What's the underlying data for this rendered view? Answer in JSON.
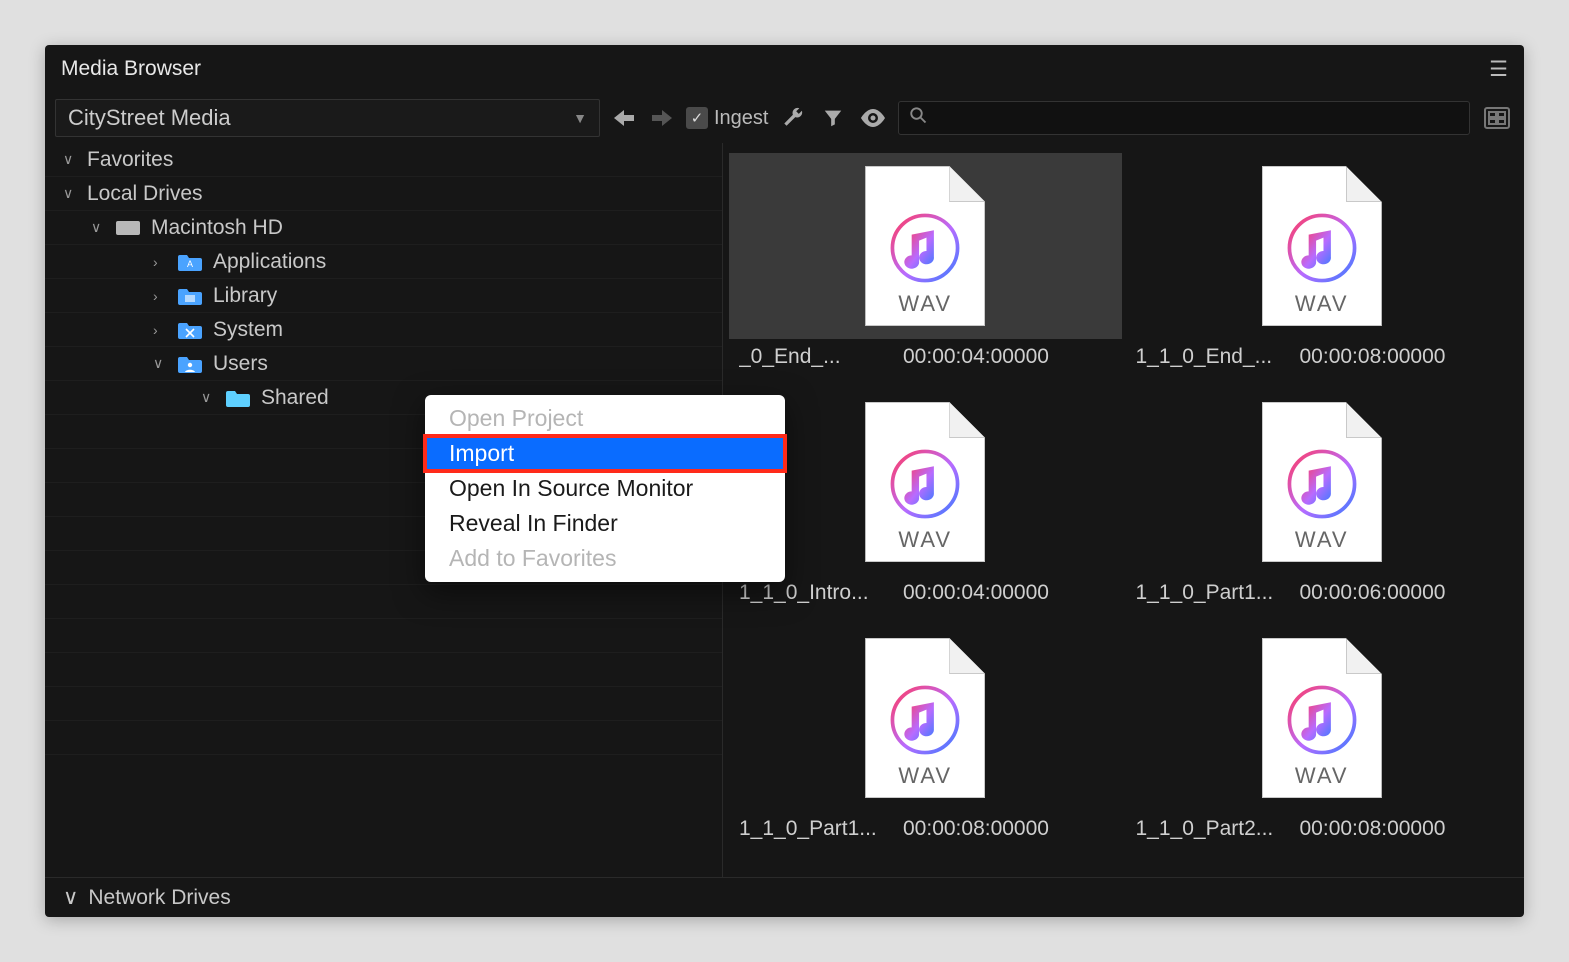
{
  "panel": {
    "title": "Media Browser"
  },
  "toolbar": {
    "dropdown": "CityStreet Media",
    "ingest_label": "Ingest",
    "search_placeholder": ""
  },
  "tree": {
    "favorites": "Favorites",
    "local_drives": "Local Drives",
    "children": [
      {
        "label": "Macintosh HD",
        "type": "hdd"
      },
      {
        "label": "Applications",
        "type": "folder"
      },
      {
        "label": "Library",
        "type": "folder"
      },
      {
        "label": "System",
        "type": "folder"
      },
      {
        "label": "Users",
        "type": "folder"
      },
      {
        "label": "Shared",
        "type": "folder-open"
      }
    ],
    "network_drives": "Network Drives"
  },
  "context_menu": {
    "items": [
      {
        "label": "Open Project",
        "disabled": true
      },
      {
        "label": "Import",
        "highlight": true
      },
      {
        "label": "Open In Source Monitor"
      },
      {
        "label": "Reveal In Finder"
      },
      {
        "label": "Add to Favorites",
        "disabled": true
      }
    ]
  },
  "files": [
    {
      "name": "_0_End_...",
      "duration": "00:00:04:00000",
      "ext": "WAV",
      "selected": true
    },
    {
      "name": "1_1_0_End_...",
      "duration": "00:00:08:00000",
      "ext": "WAV"
    },
    {
      "name": "1_1_0_Intro...",
      "duration": "00:00:04:00000",
      "ext": "WAV"
    },
    {
      "name": "1_1_0_Part1...",
      "duration": "00:00:06:00000",
      "ext": "WAV"
    },
    {
      "name": "1_1_0_Part1...",
      "duration": "00:00:08:00000",
      "ext": "WAV"
    },
    {
      "name": "1_1_0_Part2...",
      "duration": "00:00:08:00000",
      "ext": "WAV"
    }
  ]
}
